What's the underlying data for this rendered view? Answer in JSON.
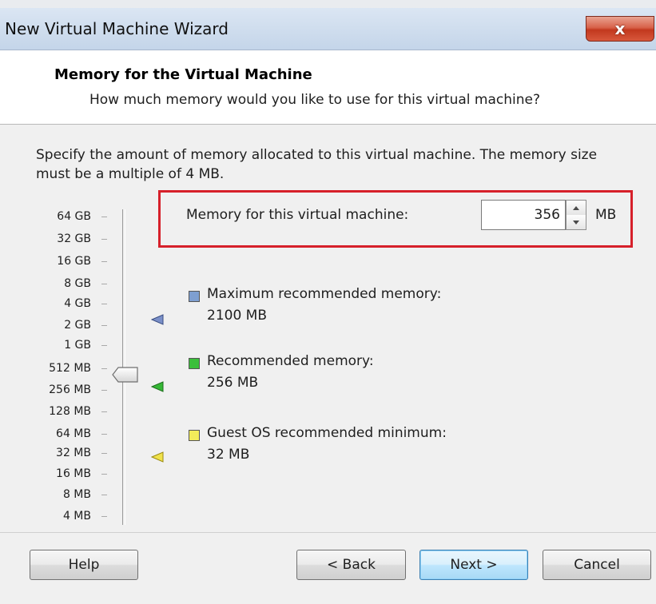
{
  "window": {
    "title": "New Virtual Machine Wizard",
    "close_glyph": "x"
  },
  "header": {
    "title": "Memory for the Virtual Machine",
    "subtitle": "How much memory would you like to use for this virtual machine?"
  },
  "description": "Specify the amount of memory allocated to this virtual machine. The memory size must be a multiple of 4 MB.",
  "scale": {
    "labels": [
      "64 GB",
      "32 GB",
      "16 GB",
      "8 GB",
      "4 GB",
      "2 GB",
      "1 GB",
      "512 MB",
      "256 MB",
      "128 MB",
      "64 MB",
      "32 MB",
      "16 MB",
      "8 MB",
      "4 MB"
    ],
    "selected": "256 MB"
  },
  "memory": {
    "label": "Memory for this virtual machine:",
    "value": "356",
    "unit": "MB"
  },
  "legend": [
    {
      "title": "Maximum recommended memory:",
      "value": "2100 MB",
      "color": "#7e9fd1",
      "marker_color": "#7a8fc8"
    },
    {
      "title": "Recommended memory:",
      "value": "256 MB",
      "color": "#3bbf3b",
      "marker_color": "#35b735"
    },
    {
      "title": "Guest OS recommended minimum:",
      "value": "32 MB",
      "color": "#f3ec5a",
      "marker_color": "#e8d93a"
    }
  ],
  "footer": {
    "help": "Help",
    "back": "< Back",
    "next": "Next >",
    "cancel": "Cancel"
  }
}
